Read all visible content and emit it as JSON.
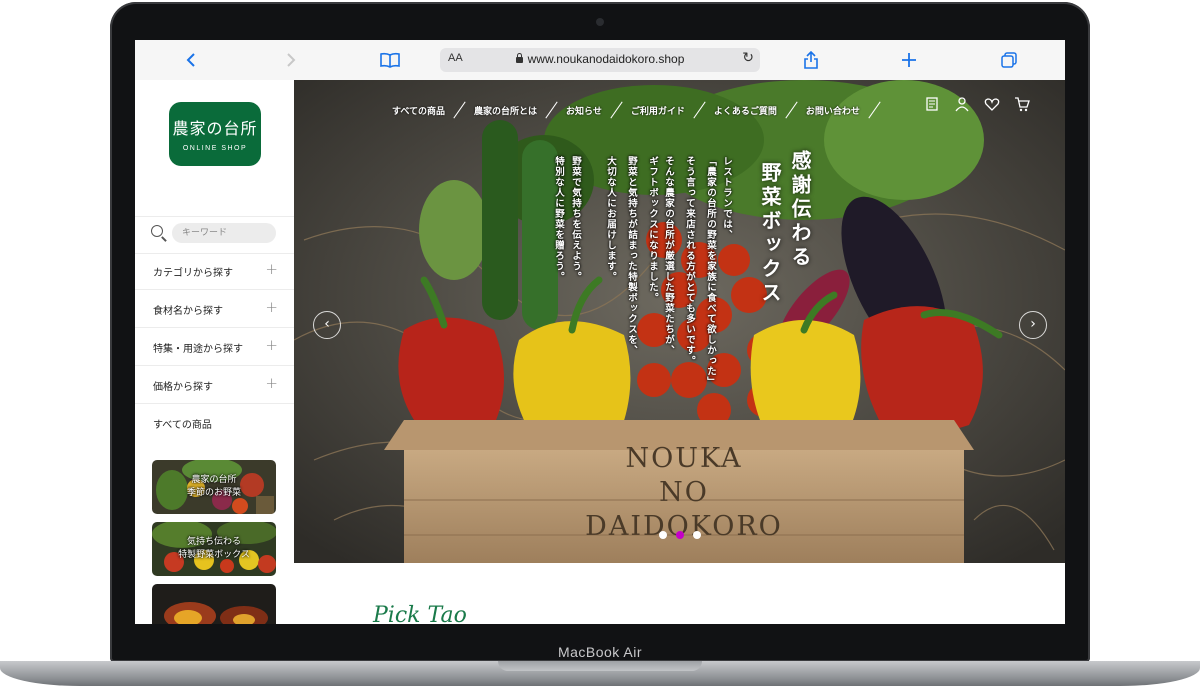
{
  "device": {
    "brand_label": "MacBook Air"
  },
  "browser": {
    "back_icon": "chevron-left-icon",
    "forward_icon": "chevron-right-icon",
    "text_size_label": "AA",
    "url": "www.noukanodaidokoro.shop",
    "colors": {
      "accent": "#1a73e8",
      "toolbar_bg": "#f6f6f6"
    }
  },
  "sidebar": {
    "logo": {
      "main": "農家の台所",
      "sub": "ONLINE SHOP",
      "color": "#0a6b3a"
    },
    "search": {
      "placeholder": "キーワード"
    },
    "menu": [
      {
        "label": "カテゴリから探す",
        "expand": "+"
      },
      {
        "label": "食材名から探す",
        "expand": "+"
      },
      {
        "label": "特集・用途から探す",
        "expand": "+"
      },
      {
        "label": "価格から探す",
        "expand": "+"
      },
      {
        "label": "すべての商品"
      }
    ],
    "banners": [
      {
        "line1": "農家の台所",
        "line2": "季節のお野菜"
      },
      {
        "line1": "気持ち伝わる",
        "line2": "特製野菜ボックス"
      },
      {
        "line1": "",
        "line2": ""
      }
    ]
  },
  "hero": {
    "nav": [
      "すべての商品",
      "農家の台所とは",
      "お知らせ",
      "ご利用ガイド",
      "よくあるご質問",
      "お問い合わせ"
    ],
    "nav_icons": [
      "guide-icon",
      "user-icon",
      "heart-icon",
      "cart-icon"
    ],
    "title_col1": "感謝伝わる",
    "title_col2": "野菜ボックス",
    "body": [
      "レストランでは、",
      "「農家の台所の野菜を家族に食べて欲しかった」",
      "そう言って来店される方がとても多いです。",
      "そんな農家の台所が厳選した野菜たちが、",
      "ギフトボックスになりました。",
      "野菜と気持ちが詰まった特製ボックスを、",
      "大切な人にお届けします。",
      "野菜で気持ちを伝えよう。",
      "特別な人に野菜を贈ろう。"
    ],
    "crate_text": [
      "NOUKA",
      "NO",
      "DAIDOKORO"
    ],
    "prev_arrow": "‹",
    "next_arrow": "›",
    "slides_total": 3,
    "slide_active_index": 2,
    "dot_active_color": "#c400c8"
  },
  "section": {
    "script_title": "Pick Tao"
  }
}
